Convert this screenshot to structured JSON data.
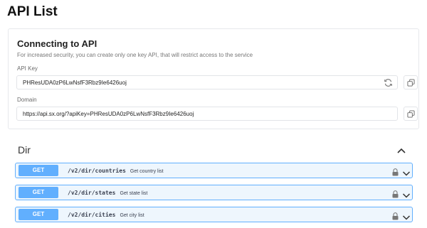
{
  "page": {
    "title": "API List"
  },
  "connect": {
    "title": "Connecting to API",
    "description": "For increased security, you can create only one key API, that will restrict access to the service",
    "api_key_label": "API Key",
    "api_key_value": "PHResUDA0zP6LwNsfF3Rbz9Ie6426uoj",
    "domain_label": "Domain",
    "domain_value": "https://api.sx.org/?apiKey=PHResUDA0zP6LwNsfF3Rbz9Ie6426uoj"
  },
  "section": {
    "title": "Dir"
  },
  "endpoints": [
    {
      "method": "GET",
      "path": "/v2/dir/countries",
      "summary": "Get country list"
    },
    {
      "method": "GET",
      "path": "/v2/dir/states",
      "summary": "Get state list"
    },
    {
      "method": "GET",
      "path": "/v2/dir/cities",
      "summary": "Get city list"
    }
  ],
  "icons": {
    "refresh": "refresh-icon",
    "copy": "copy-icon",
    "collapse": "chevron-up-icon",
    "lock": "lock-icon",
    "expand": "chevron-down-icon"
  },
  "colors": {
    "get_method": "#61affe",
    "get_background": "#eef6fd",
    "border": "#e2e4e8"
  }
}
